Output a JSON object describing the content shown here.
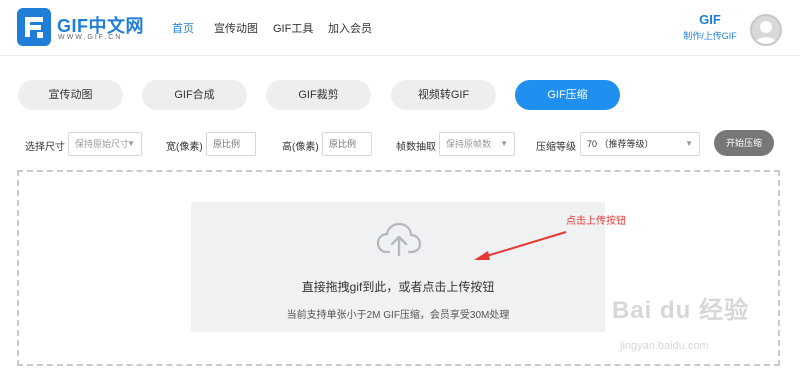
{
  "header": {
    "logo_title": "GIF中文网",
    "logo_sub": "WWW.GIF.CN",
    "nav": [
      {
        "label": "首页",
        "active": true
      },
      {
        "label": "宣传动图",
        "active": false
      },
      {
        "label": "GIF工具",
        "active": false
      },
      {
        "label": "加入会员",
        "active": false
      }
    ],
    "brand_gif": "GIF",
    "brand_sub": "制作/上传GIF"
  },
  "tabs": [
    {
      "label": "宣传动图",
      "active": false
    },
    {
      "label": "GIF合成",
      "active": false
    },
    {
      "label": "GIF裁剪",
      "active": false
    },
    {
      "label": "视频转GIF",
      "active": false
    },
    {
      "label": "GIF压缩",
      "active": true
    }
  ],
  "options": {
    "size_label": "选择尺寸",
    "size_value": "保持原始尺寸",
    "width_label": "宽(像素)",
    "width_placeholder": "原比例",
    "height_label": "高(像素)",
    "height_placeholder": "原比例",
    "frame_label": "帧数抽取",
    "frame_value": "保持原帧数",
    "level_label": "压缩等级",
    "level_value": "70 （推荐等级）",
    "start_label": "开始压缩"
  },
  "dropzone": {
    "main_text": "直接拖拽gif到此，或者点击上传按钮",
    "sub_text": "当前支持单张小于2M GIF压缩，会员享受30M处理"
  },
  "annotation": {
    "text": "点击上传按钮",
    "color": "#e53935"
  },
  "watermark": {
    "main": "Bai du 经验",
    "sub": "jingyan.baidu.com"
  },
  "colors": {
    "accent": "#1f8ff0",
    "brand": "#1f7fd8"
  }
}
